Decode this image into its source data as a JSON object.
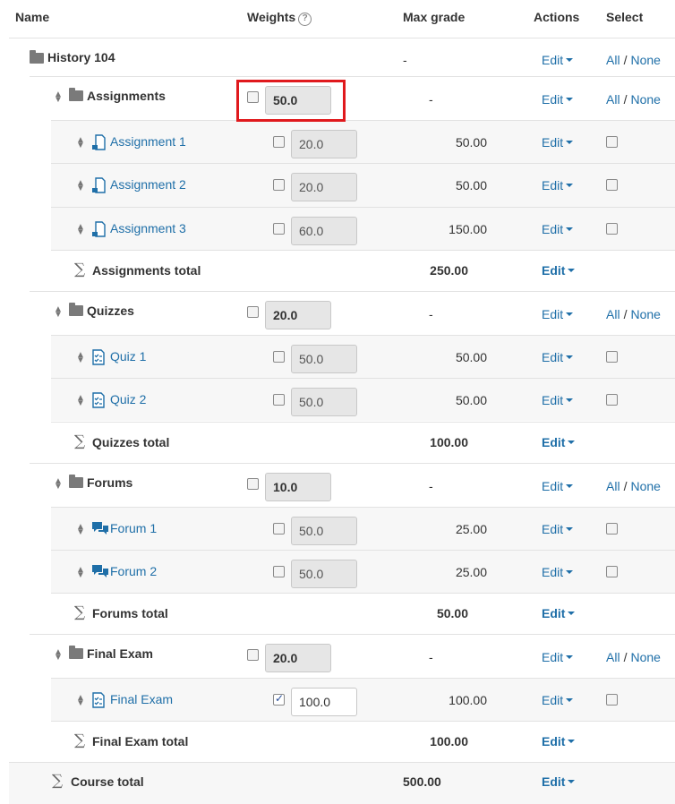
{
  "headers": {
    "name": "Name",
    "weights": "Weights",
    "weights_help": "?",
    "max_grade": "Max grade",
    "actions": "Actions",
    "select": "Select"
  },
  "edit_label": "Edit",
  "select_all": "All",
  "select_sep": "/",
  "select_none": "None",
  "course": {
    "name": "History 104",
    "max": "-",
    "total_label": "Course total",
    "total_max": "500.00"
  },
  "categories": [
    {
      "name": "Assignments",
      "weight": "50.0",
      "max": "-",
      "items": [
        {
          "name": "Assignment 1",
          "weight": "20.0",
          "max": "50.00",
          "icon": "assignment-icon"
        },
        {
          "name": "Assignment 2",
          "weight": "20.0",
          "max": "50.00",
          "icon": "assignment-icon"
        },
        {
          "name": "Assignment 3",
          "weight": "60.0",
          "max": "150.00",
          "icon": "assignment-icon"
        }
      ],
      "total_label": "Assignments total",
      "total_max": "250.00"
    },
    {
      "name": "Quizzes",
      "weight": "20.0",
      "max": "-",
      "items": [
        {
          "name": "Quiz 1",
          "weight": "50.0",
          "max": "50.00",
          "icon": "quiz-icon"
        },
        {
          "name": "Quiz 2",
          "weight": "50.0",
          "max": "50.00",
          "icon": "quiz-icon"
        }
      ],
      "total_label": "Quizzes total",
      "total_max": "100.00"
    },
    {
      "name": "Forums",
      "weight": "10.0",
      "max": "-",
      "items": [
        {
          "name": "Forum 1",
          "weight": "50.0",
          "max": "25.00",
          "icon": "forum-icon"
        },
        {
          "name": "Forum 2",
          "weight": "50.0",
          "max": "25.00",
          "icon": "forum-icon"
        }
      ],
      "total_label": "Forums total",
      "total_max": "50.00"
    },
    {
      "name": "Final Exam",
      "weight": "20.0",
      "max": "-",
      "items": [
        {
          "name": "Final Exam",
          "weight": "100.0",
          "max": "100.00",
          "icon": "quiz-icon",
          "override_checked": true
        }
      ],
      "total_label": "Final Exam total",
      "total_max": "100.00"
    }
  ]
}
